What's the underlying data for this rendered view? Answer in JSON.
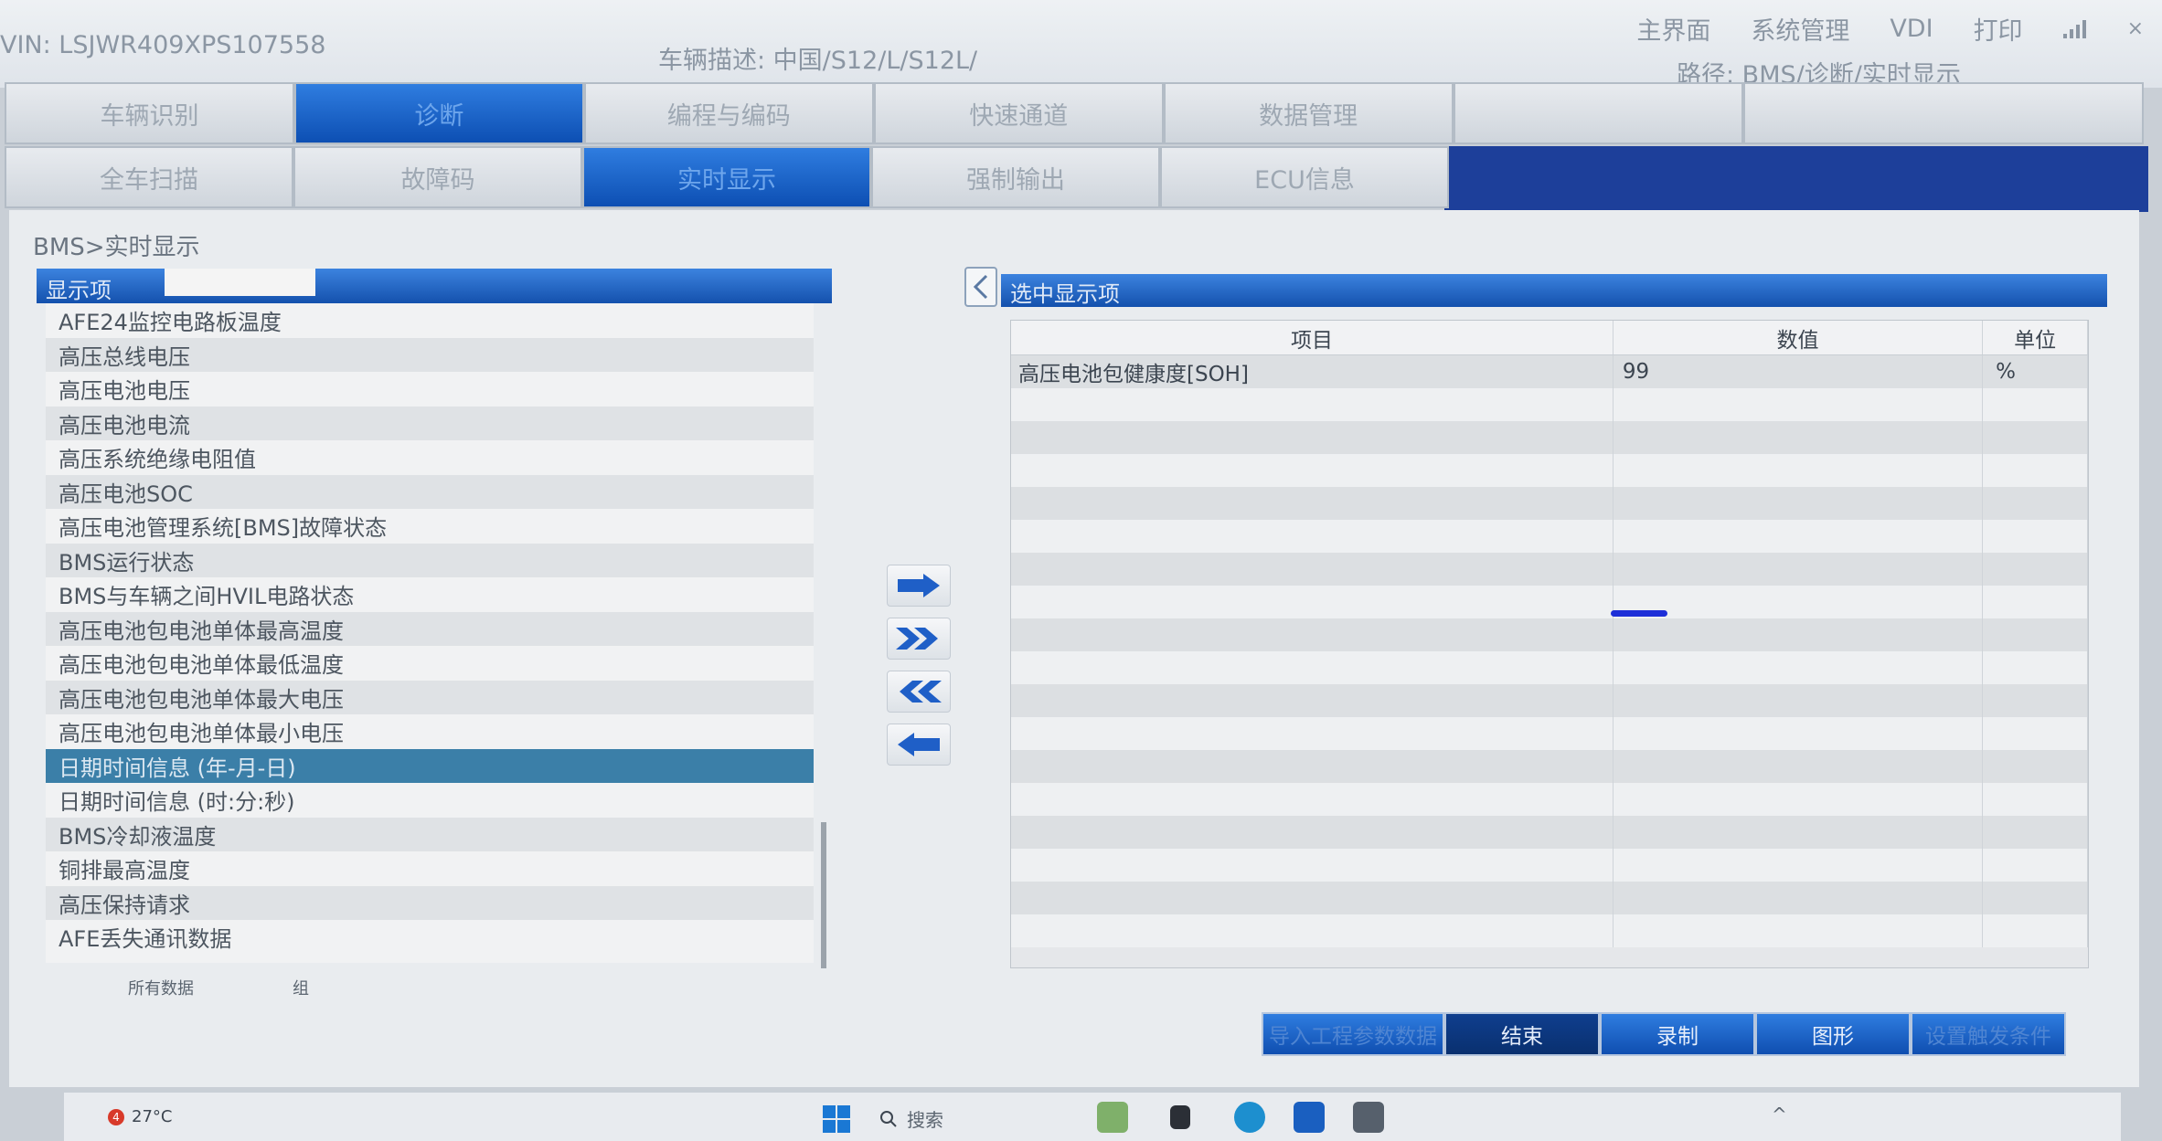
{
  "header": {
    "vin": "VIN: LSJWR409XPS107558",
    "vehicle_desc": "车辆描述: 中国/S12/L/S12L/",
    "path": "路径: BMS/诊断/实时显示",
    "nav": [
      "主界面",
      "系统管理",
      "VDI",
      "打印"
    ]
  },
  "tabs_row1": [
    "车辆识别",
    "诊断",
    "编程与编码",
    "快速通道",
    "数据管理"
  ],
  "tabs_row2": [
    "全车扫描",
    "故障码",
    "实时显示",
    "强制输出",
    "ECU信息"
  ],
  "breadcrumb": "BMS>实时显示",
  "left_panel": {
    "title": "显示项",
    "items": [
      "AFE24监控电路板温度",
      "高压总线电压",
      "高压电池电压",
      "高压电池电流",
      "高压系统绝缘电阻值",
      "高压电池SOC",
      "高压电池管理系统[BMS]故障状态",
      "BMS运行状态",
      "BMS与车辆之间HVIL电路状态",
      "高压电池包电池单体最高温度",
      "高压电池包电池单体最低温度",
      "高压电池包电池单体最大电压",
      "高压电池包电池单体最小电压",
      "日期时间信息 (年-月-日)",
      "日期时间信息 (时:分:秒)",
      "BMS冷却液温度",
      "铜排最高温度",
      "高压保持请求",
      "AFE丢失通讯数据"
    ],
    "selected_index": 13,
    "footer_all": "所有数据",
    "footer_group": "组"
  },
  "right_panel": {
    "title": "选中显示项",
    "columns": [
      "项目",
      "数值",
      "单位"
    ],
    "rows": [
      {
        "item": "高压电池包健康度[SOH]",
        "value": "99",
        "unit": "%"
      }
    ]
  },
  "buttons": {
    "import": "导入工程参数数据",
    "end": "结束",
    "record": "录制",
    "graph": "图形",
    "extra": "设置触发条件"
  },
  "taskbar": {
    "weather_badge": "4",
    "temperature": "27°C",
    "search": "搜索"
  },
  "colors": {
    "accent_blue": "#1451ad",
    "selected_row": "#3b7fa8",
    "pen_mark": "#1d2fd8"
  }
}
